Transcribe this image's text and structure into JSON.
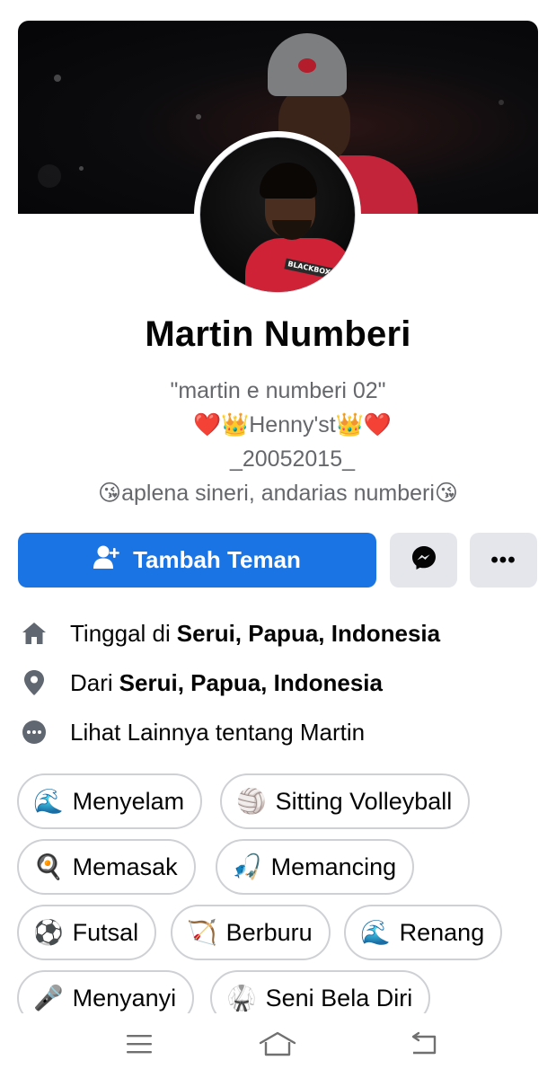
{
  "profile": {
    "name": "Martin Numberi",
    "bio": {
      "line1": "\"martin e numberi 02\"",
      "line2": "❤️👑Henny'st👑❤️",
      "line3": "_20052015_",
      "line4": "😘aplena sineri, andarias numberi😘"
    }
  },
  "actions": {
    "add_friend_label": "Tambah Teman",
    "more_label": "•••"
  },
  "info": {
    "lives_prefix": "Tinggal di",
    "lives_value": "Serui, Papua, Indonesia",
    "from_prefix": "Dari",
    "from_value": "Serui, Papua, Indonesia",
    "see_more": "Lihat Lainnya tentang Martin"
  },
  "hobbies": [
    {
      "emoji": "🌊",
      "label": "Menyelam"
    },
    {
      "emoji": "🏐",
      "label": "Sitting Volleyball"
    },
    {
      "emoji": "🍳",
      "label": "Memasak"
    },
    {
      "emoji": "🎣",
      "label": "Memancing"
    },
    {
      "emoji": "⚽",
      "label": "Futsal"
    },
    {
      "emoji": "🏹",
      "label": "Berburu"
    },
    {
      "emoji": "🌊",
      "label": "Renang"
    },
    {
      "emoji": "🎤",
      "label": "Menyanyi"
    },
    {
      "emoji": "🥋",
      "label": "Seni Bela Diri"
    }
  ],
  "colors": {
    "primary": "#1b74e4",
    "button_gray": "#e4e6eb",
    "secondary_text": "#65676b",
    "icon_gray": "#606770"
  },
  "icons": {
    "home": "home-icon",
    "location": "location-pin-icon",
    "more": "more-dots-icon",
    "messenger": "messenger-icon",
    "add_friend": "add-friend-icon"
  }
}
